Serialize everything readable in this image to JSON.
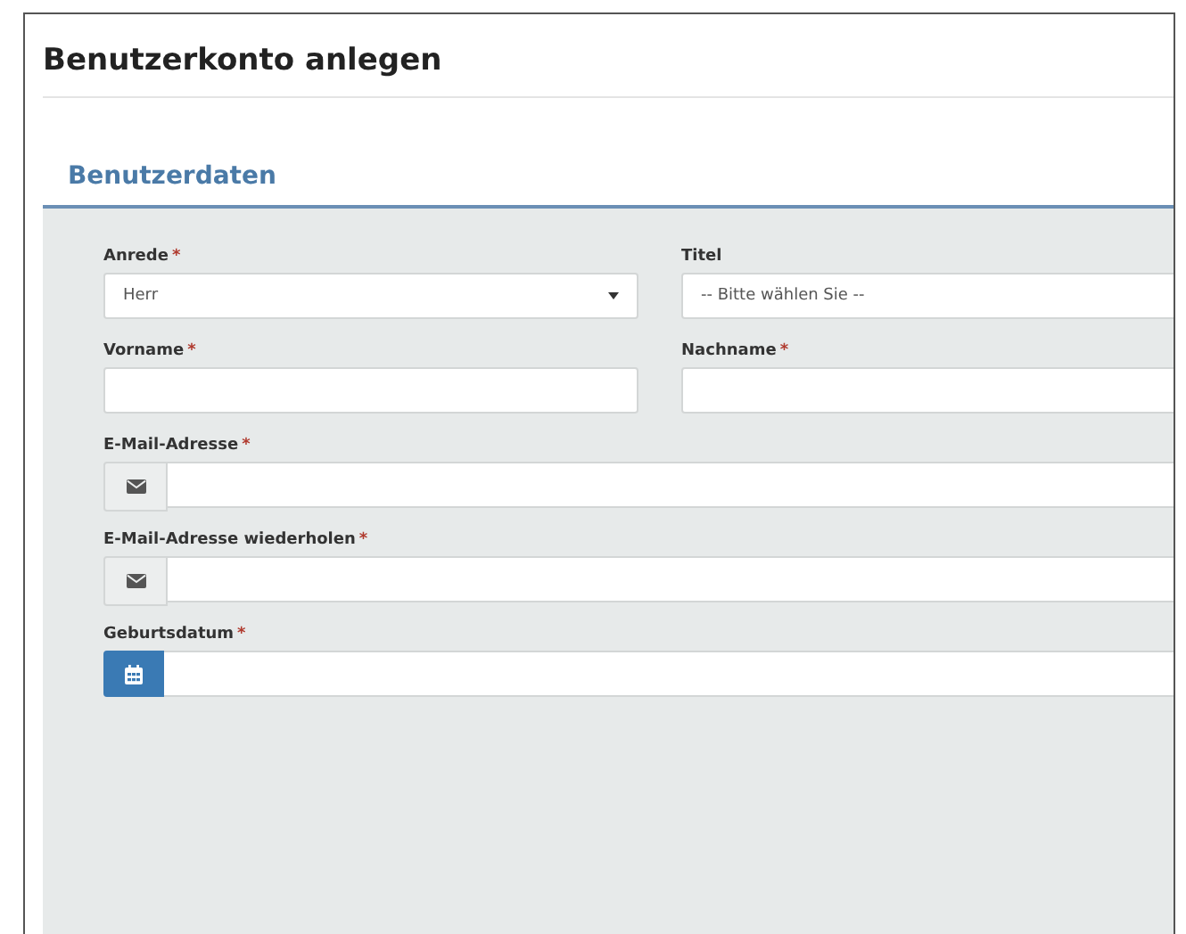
{
  "page_title": "Benutzerkonto anlegen",
  "section": {
    "title": "Benutzerdaten"
  },
  "rows": [
    {
      "fields": [
        {
          "kind": "select",
          "label": "Anrede",
          "required_mark": "*",
          "value": "Herr"
        },
        {
          "kind": "select-open",
          "label": "Titel",
          "value": "-- Bitte wählen Sie --"
        }
      ]
    },
    {
      "fields": [
        {
          "kind": "text",
          "label": "Vorname",
          "required_mark": "*"
        },
        {
          "kind": "text",
          "label": "Nachname",
          "required_mark": "*"
        }
      ]
    },
    {
      "fields": [
        {
          "kind": "email",
          "label": "E-Mail-Adresse",
          "required_mark": "*"
        }
      ]
    },
    {
      "fields": [
        {
          "kind": "email",
          "label": "E-Mail-Adresse wiederholen",
          "required_mark": "*"
        }
      ]
    },
    {
      "fields": [
        {
          "kind": "date",
          "label": "Geburtsdatum",
          "required_mark": "*"
        }
      ]
    }
  ]
}
